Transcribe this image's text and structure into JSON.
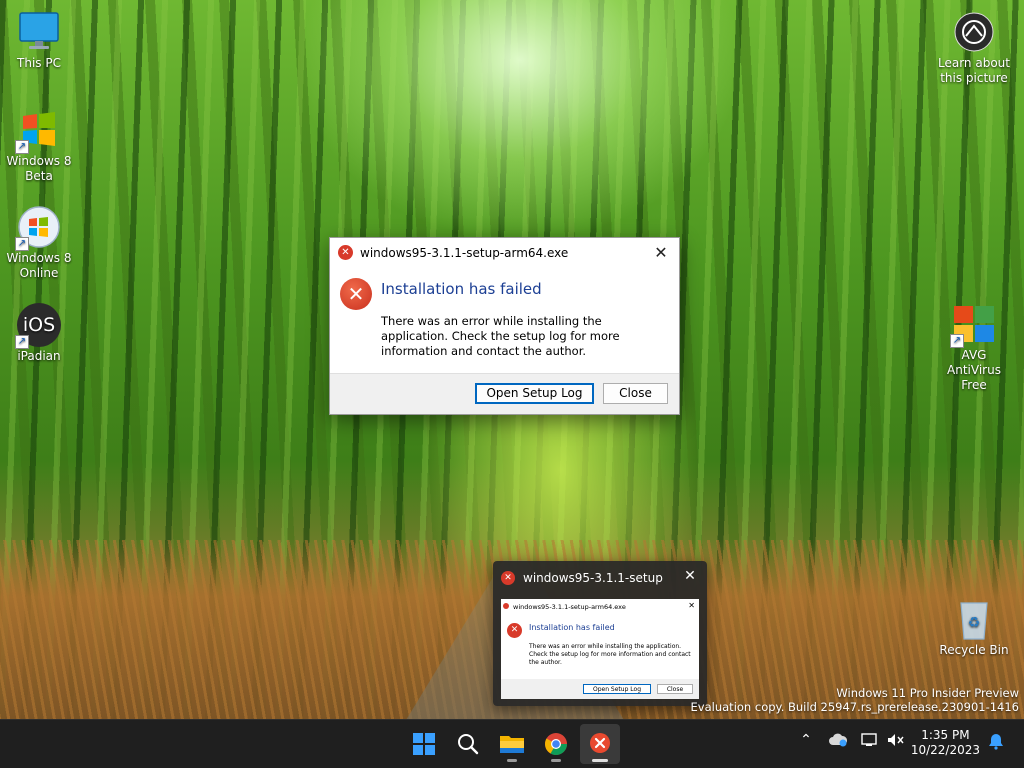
{
  "desktop": {
    "icons_left": [
      {
        "label_line1": "This PC",
        "label_line2": ""
      },
      {
        "label_line1": "Windows 8",
        "label_line2": "Beta"
      },
      {
        "label_line1": "Windows 8",
        "label_line2": "Online"
      },
      {
        "label_line1": "iPadian",
        "label_line2": ""
      }
    ],
    "ipadian_glyph": "iOS",
    "icons_right": [
      {
        "label_line1": "Learn about",
        "label_line2": "this picture"
      },
      {
        "label_line1": "AVG AntiVirus",
        "label_line2": "Free"
      },
      {
        "label_line1": "Recycle Bin",
        "label_line2": ""
      }
    ]
  },
  "dialog": {
    "title": "windows95-3.1.1-setup-arm64.exe",
    "close_glyph": "✕",
    "heading": "Installation has failed",
    "message": "There was an error while installing the application. Check the setup log for more information and contact the author.",
    "open_log_label": "Open Setup Log",
    "close_label": "Close"
  },
  "preview": {
    "title": "windows95-3.1.1-setup-...",
    "close_glyph": "✕",
    "mini_title": "windows95-3.1.1-setup-arm64.exe",
    "mini_heading": "Installation has failed",
    "mini_message": "There was an error while installing the application. Check the setup log for more information and contact the author.",
    "mini_open_log": "Open Setup Log",
    "mini_close": "Close"
  },
  "watermark": {
    "line1": "Windows 11 Pro Insider Preview",
    "line2": "Evaluation copy. Build 25947.rs_prerelease.230901-1416"
  },
  "taskbar": {
    "apps": [
      "start-icon",
      "search-icon",
      "file-explorer-icon",
      "chrome-icon",
      "setup-error-app-icon"
    ],
    "tray_chevron": "⌃",
    "time": "1:35 PM",
    "date": "10/22/2023"
  },
  "colors": {
    "accent": "#0067c0",
    "error": "#d83a2a",
    "heading": "#1c3f94",
    "taskbar": "#1f1f1f"
  }
}
